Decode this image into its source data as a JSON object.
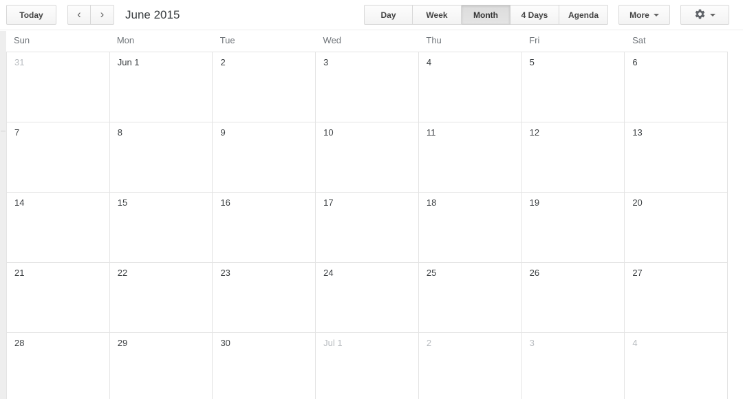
{
  "toolbar": {
    "today_label": "Today",
    "prev_label": "‹",
    "next_label": "›",
    "period_title": "June 2015",
    "views": [
      {
        "label": "Day",
        "active": false
      },
      {
        "label": "Week",
        "active": false
      },
      {
        "label": "Month",
        "active": true
      },
      {
        "label": "4 Days",
        "active": false
      },
      {
        "label": "Agenda",
        "active": false
      }
    ],
    "more_label": "More",
    "settings_label": "gear-icon"
  },
  "calendar": {
    "day_headers": [
      "Sun",
      "Mon",
      "Tue",
      "Wed",
      "Thu",
      "Fri",
      "Sat"
    ],
    "weeks": [
      [
        {
          "label": "31",
          "other_month": true
        },
        {
          "label": "Jun 1",
          "other_month": false
        },
        {
          "label": "2",
          "other_month": false
        },
        {
          "label": "3",
          "other_month": false
        },
        {
          "label": "4",
          "other_month": false
        },
        {
          "label": "5",
          "other_month": false
        },
        {
          "label": "6",
          "other_month": false
        }
      ],
      [
        {
          "label": "7",
          "other_month": false
        },
        {
          "label": "8",
          "other_month": false
        },
        {
          "label": "9",
          "other_month": false
        },
        {
          "label": "10",
          "other_month": false
        },
        {
          "label": "11",
          "other_month": false
        },
        {
          "label": "12",
          "other_month": false
        },
        {
          "label": "13",
          "other_month": false
        }
      ],
      [
        {
          "label": "14",
          "other_month": false
        },
        {
          "label": "15",
          "other_month": false
        },
        {
          "label": "16",
          "other_month": false
        },
        {
          "label": "17",
          "other_month": false
        },
        {
          "label": "18",
          "other_month": false
        },
        {
          "label": "19",
          "other_month": false
        },
        {
          "label": "20",
          "other_month": false
        }
      ],
      [
        {
          "label": "21",
          "other_month": false
        },
        {
          "label": "22",
          "other_month": false
        },
        {
          "label": "23",
          "other_month": false
        },
        {
          "label": "24",
          "other_month": false
        },
        {
          "label": "25",
          "other_month": false
        },
        {
          "label": "26",
          "other_month": false
        },
        {
          "label": "27",
          "other_month": false
        }
      ],
      [
        {
          "label": "28",
          "other_month": false
        },
        {
          "label": "29",
          "other_month": false
        },
        {
          "label": "30",
          "other_month": false
        },
        {
          "label": "Jul 1",
          "other_month": true
        },
        {
          "label": "2",
          "other_month": true
        },
        {
          "label": "3",
          "other_month": true
        },
        {
          "label": "4",
          "other_month": true
        }
      ]
    ]
  },
  "colors": {
    "grid_line": "#e4e4e4",
    "text_primary": "#3c4043",
    "text_muted": "#70757a",
    "text_other_month": "#b8bcc0",
    "sidebar_strip": "#eeeeee",
    "active_button": "#e0e0e0"
  }
}
